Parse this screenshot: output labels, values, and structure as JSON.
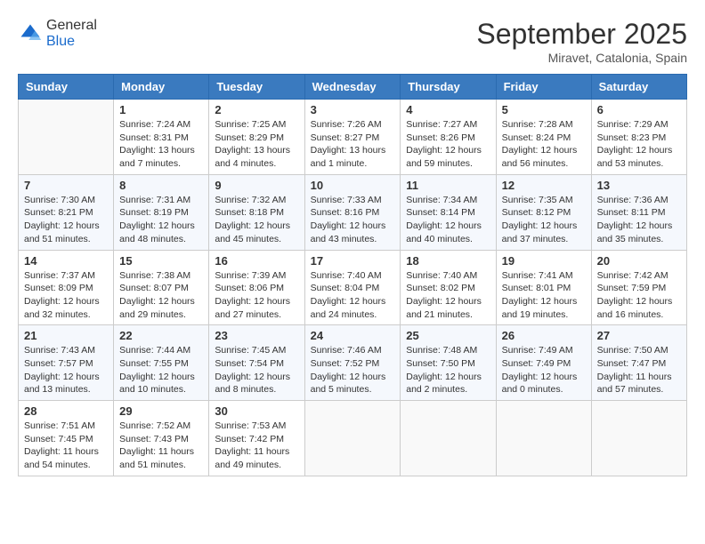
{
  "header": {
    "logo_general": "General",
    "logo_blue": "Blue",
    "month_title": "September 2025",
    "location": "Miravet, Catalonia, Spain"
  },
  "days_of_week": [
    "Sunday",
    "Monday",
    "Tuesday",
    "Wednesday",
    "Thursday",
    "Friday",
    "Saturday"
  ],
  "weeks": [
    [
      {
        "num": "",
        "sunrise": "",
        "sunset": "",
        "daylight": "",
        "empty": true
      },
      {
        "num": "1",
        "sunrise": "Sunrise: 7:24 AM",
        "sunset": "Sunset: 8:31 PM",
        "daylight": "Daylight: 13 hours and 7 minutes."
      },
      {
        "num": "2",
        "sunrise": "Sunrise: 7:25 AM",
        "sunset": "Sunset: 8:29 PM",
        "daylight": "Daylight: 13 hours and 4 minutes."
      },
      {
        "num": "3",
        "sunrise": "Sunrise: 7:26 AM",
        "sunset": "Sunset: 8:27 PM",
        "daylight": "Daylight: 13 hours and 1 minute."
      },
      {
        "num": "4",
        "sunrise": "Sunrise: 7:27 AM",
        "sunset": "Sunset: 8:26 PM",
        "daylight": "Daylight: 12 hours and 59 minutes."
      },
      {
        "num": "5",
        "sunrise": "Sunrise: 7:28 AM",
        "sunset": "Sunset: 8:24 PM",
        "daylight": "Daylight: 12 hours and 56 minutes."
      },
      {
        "num": "6",
        "sunrise": "Sunrise: 7:29 AM",
        "sunset": "Sunset: 8:23 PM",
        "daylight": "Daylight: 12 hours and 53 minutes."
      }
    ],
    [
      {
        "num": "7",
        "sunrise": "Sunrise: 7:30 AM",
        "sunset": "Sunset: 8:21 PM",
        "daylight": "Daylight: 12 hours and 51 minutes."
      },
      {
        "num": "8",
        "sunrise": "Sunrise: 7:31 AM",
        "sunset": "Sunset: 8:19 PM",
        "daylight": "Daylight: 12 hours and 48 minutes."
      },
      {
        "num": "9",
        "sunrise": "Sunrise: 7:32 AM",
        "sunset": "Sunset: 8:18 PM",
        "daylight": "Daylight: 12 hours and 45 minutes."
      },
      {
        "num": "10",
        "sunrise": "Sunrise: 7:33 AM",
        "sunset": "Sunset: 8:16 PM",
        "daylight": "Daylight: 12 hours and 43 minutes."
      },
      {
        "num": "11",
        "sunrise": "Sunrise: 7:34 AM",
        "sunset": "Sunset: 8:14 PM",
        "daylight": "Daylight: 12 hours and 40 minutes."
      },
      {
        "num": "12",
        "sunrise": "Sunrise: 7:35 AM",
        "sunset": "Sunset: 8:12 PM",
        "daylight": "Daylight: 12 hours and 37 minutes."
      },
      {
        "num": "13",
        "sunrise": "Sunrise: 7:36 AM",
        "sunset": "Sunset: 8:11 PM",
        "daylight": "Daylight: 12 hours and 35 minutes."
      }
    ],
    [
      {
        "num": "14",
        "sunrise": "Sunrise: 7:37 AM",
        "sunset": "Sunset: 8:09 PM",
        "daylight": "Daylight: 12 hours and 32 minutes."
      },
      {
        "num": "15",
        "sunrise": "Sunrise: 7:38 AM",
        "sunset": "Sunset: 8:07 PM",
        "daylight": "Daylight: 12 hours and 29 minutes."
      },
      {
        "num": "16",
        "sunrise": "Sunrise: 7:39 AM",
        "sunset": "Sunset: 8:06 PM",
        "daylight": "Daylight: 12 hours and 27 minutes."
      },
      {
        "num": "17",
        "sunrise": "Sunrise: 7:40 AM",
        "sunset": "Sunset: 8:04 PM",
        "daylight": "Daylight: 12 hours and 24 minutes."
      },
      {
        "num": "18",
        "sunrise": "Sunrise: 7:40 AM",
        "sunset": "Sunset: 8:02 PM",
        "daylight": "Daylight: 12 hours and 21 minutes."
      },
      {
        "num": "19",
        "sunrise": "Sunrise: 7:41 AM",
        "sunset": "Sunset: 8:01 PM",
        "daylight": "Daylight: 12 hours and 19 minutes."
      },
      {
        "num": "20",
        "sunrise": "Sunrise: 7:42 AM",
        "sunset": "Sunset: 7:59 PM",
        "daylight": "Daylight: 12 hours and 16 minutes."
      }
    ],
    [
      {
        "num": "21",
        "sunrise": "Sunrise: 7:43 AM",
        "sunset": "Sunset: 7:57 PM",
        "daylight": "Daylight: 12 hours and 13 minutes."
      },
      {
        "num": "22",
        "sunrise": "Sunrise: 7:44 AM",
        "sunset": "Sunset: 7:55 PM",
        "daylight": "Daylight: 12 hours and 10 minutes."
      },
      {
        "num": "23",
        "sunrise": "Sunrise: 7:45 AM",
        "sunset": "Sunset: 7:54 PM",
        "daylight": "Daylight: 12 hours and 8 minutes."
      },
      {
        "num": "24",
        "sunrise": "Sunrise: 7:46 AM",
        "sunset": "Sunset: 7:52 PM",
        "daylight": "Daylight: 12 hours and 5 minutes."
      },
      {
        "num": "25",
        "sunrise": "Sunrise: 7:48 AM",
        "sunset": "Sunset: 7:50 PM",
        "daylight": "Daylight: 12 hours and 2 minutes."
      },
      {
        "num": "26",
        "sunrise": "Sunrise: 7:49 AM",
        "sunset": "Sunset: 7:49 PM",
        "daylight": "Daylight: 12 hours and 0 minutes."
      },
      {
        "num": "27",
        "sunrise": "Sunrise: 7:50 AM",
        "sunset": "Sunset: 7:47 PM",
        "daylight": "Daylight: 11 hours and 57 minutes."
      }
    ],
    [
      {
        "num": "28",
        "sunrise": "Sunrise: 7:51 AM",
        "sunset": "Sunset: 7:45 PM",
        "daylight": "Daylight: 11 hours and 54 minutes."
      },
      {
        "num": "29",
        "sunrise": "Sunrise: 7:52 AM",
        "sunset": "Sunset: 7:43 PM",
        "daylight": "Daylight: 11 hours and 51 minutes."
      },
      {
        "num": "30",
        "sunrise": "Sunrise: 7:53 AM",
        "sunset": "Sunset: 7:42 PM",
        "daylight": "Daylight: 11 hours and 49 minutes."
      },
      {
        "num": "",
        "sunrise": "",
        "sunset": "",
        "daylight": "",
        "empty": true
      },
      {
        "num": "",
        "sunrise": "",
        "sunset": "",
        "daylight": "",
        "empty": true
      },
      {
        "num": "",
        "sunrise": "",
        "sunset": "",
        "daylight": "",
        "empty": true
      },
      {
        "num": "",
        "sunrise": "",
        "sunset": "",
        "daylight": "",
        "empty": true
      }
    ]
  ]
}
